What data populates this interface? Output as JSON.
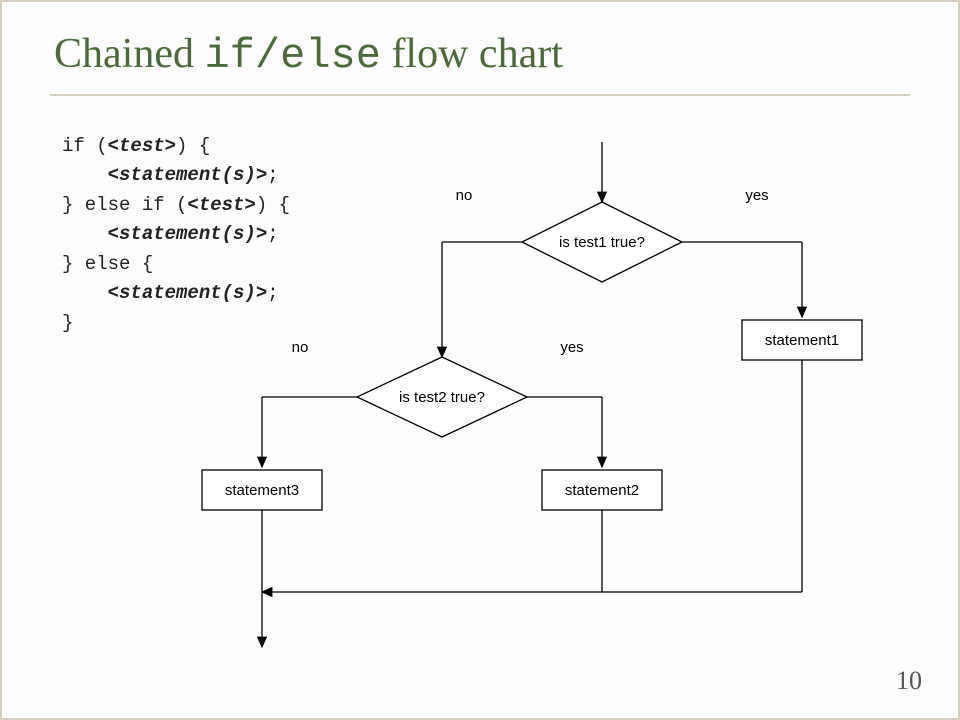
{
  "title": {
    "pre": "Chained ",
    "mono_if": "if",
    "slash": "/",
    "mono_else": "else",
    "post": " flow chart"
  },
  "code": {
    "l1a": "if (",
    "l1b": "<test>",
    "l1c": ") {",
    "l2a": "    ",
    "l2b": "<statement(s)>",
    "l2c": ";",
    "l3a": "} else if (",
    "l3b": "<test>",
    "l3c": ") {",
    "l4a": "    ",
    "l4b": "<statement(s)>",
    "l4c": ";",
    "l5": "} else {",
    "l6a": "    ",
    "l6b": "<statement(s)>",
    "l6c": ";",
    "l7": "}"
  },
  "flow": {
    "test1": "is test1 true?",
    "test2": "is test2 true?",
    "stmt1": "statement1",
    "stmt2": "statement2",
    "stmt3": "statement3",
    "yes": "yes",
    "no": "no"
  },
  "page": "10"
}
